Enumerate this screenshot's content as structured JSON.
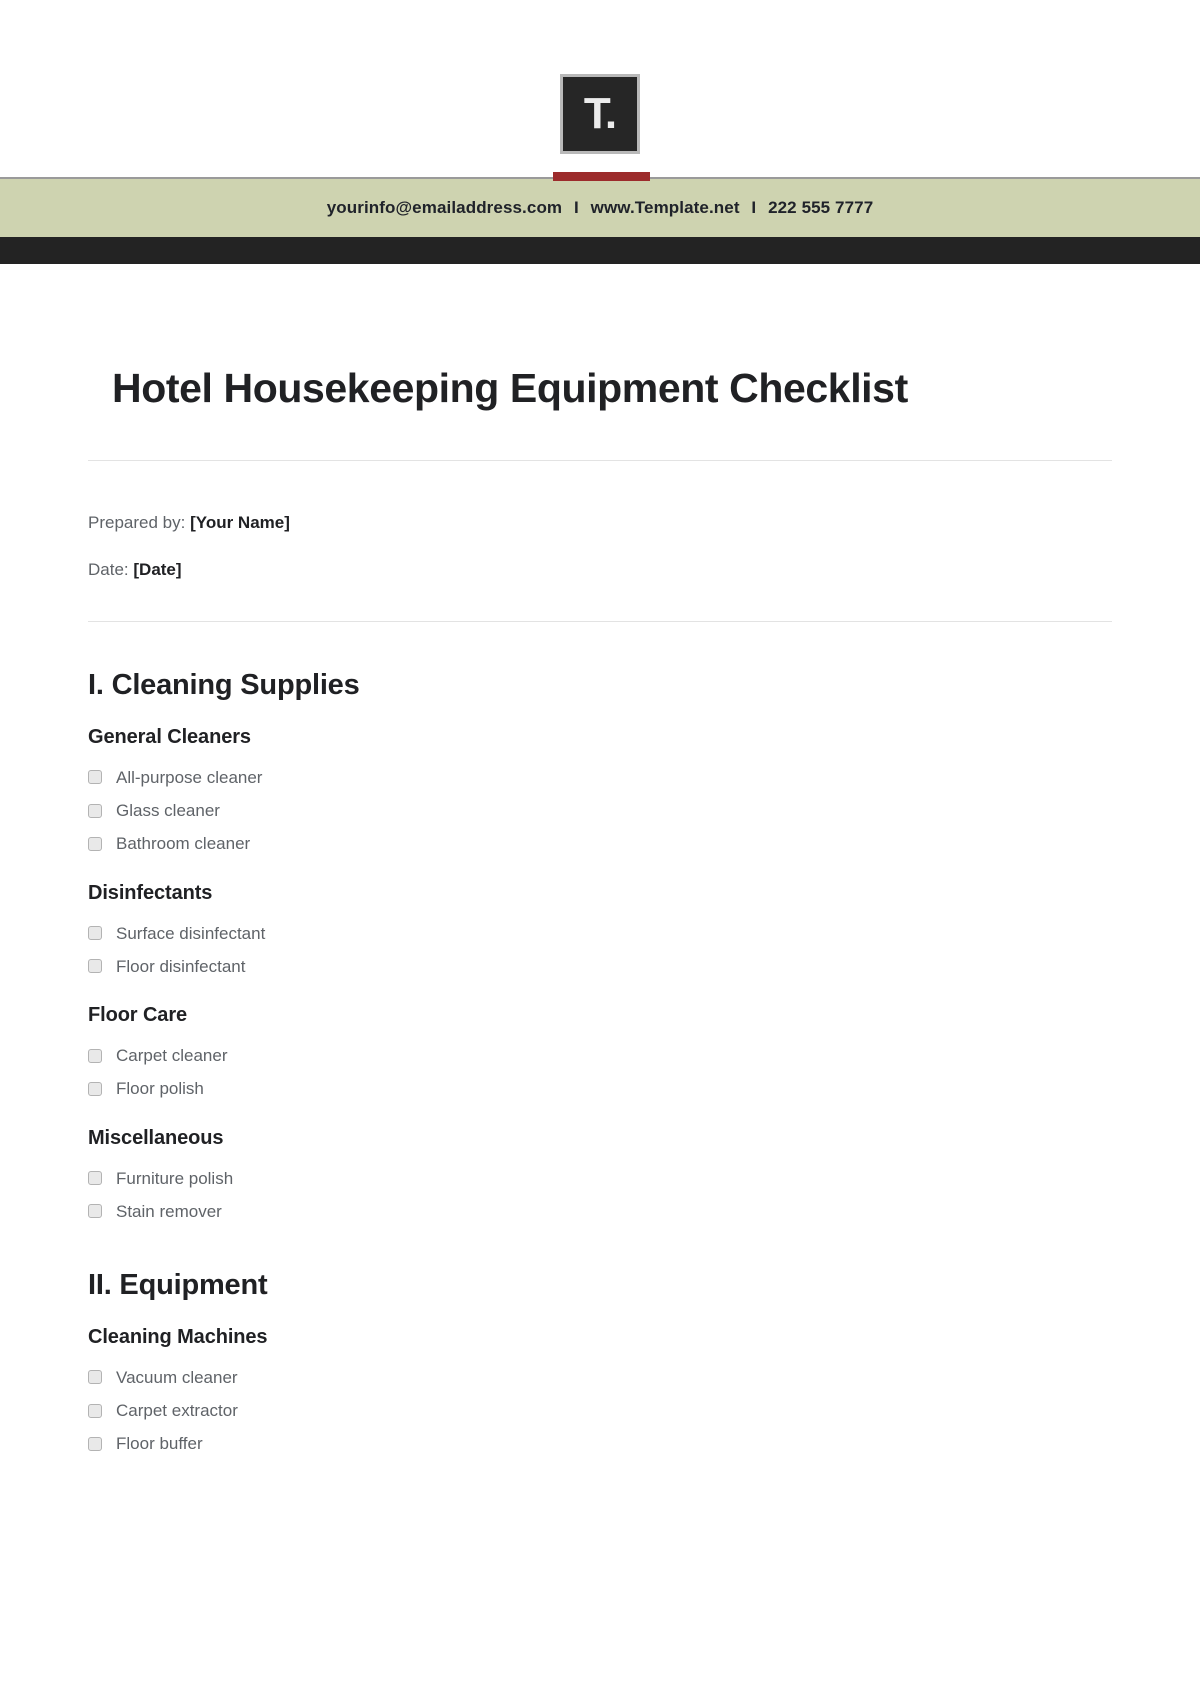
{
  "brand": {
    "logo_mark": "T.",
    "logo_icon": "template-net-logo-icon",
    "accent_red": "#9C2B2B",
    "band_green": "#CED3B0",
    "band_dark": "#232323"
  },
  "contact": {
    "email": "yourinfo@emailaddress.com",
    "separator": "I",
    "website": "www.Template.net",
    "phone": "222 555 7777"
  },
  "document": {
    "title": "Hotel Housekeeping Equipment Checklist",
    "prepared_by_label": "Prepared by:",
    "prepared_by_value": "[Your Name]",
    "date_label": "Date:",
    "date_value": "[Date]"
  },
  "sections": [
    {
      "title": "I. Cleaning Supplies",
      "groups": [
        {
          "title": "General Cleaners",
          "items": [
            {
              "label": "All-purpose cleaner",
              "checked": false
            },
            {
              "label": "Glass cleaner",
              "checked": false
            },
            {
              "label": "Bathroom cleaner",
              "checked": false
            }
          ]
        },
        {
          "title": "Disinfectants",
          "items": [
            {
              "label": "Surface disinfectant",
              "checked": false
            },
            {
              "label": "Floor disinfectant",
              "checked": false
            }
          ]
        },
        {
          "title": "Floor Care",
          "items": [
            {
              "label": "Carpet cleaner",
              "checked": false
            },
            {
              "label": "Floor polish",
              "checked": false
            }
          ]
        },
        {
          "title": "Miscellaneous",
          "items": [
            {
              "label": "Furniture polish",
              "checked": false
            },
            {
              "label": "Stain remover",
              "checked": false
            }
          ]
        }
      ]
    },
    {
      "title": "II. Equipment",
      "groups": [
        {
          "title": "Cleaning Machines",
          "items": [
            {
              "label": "Vacuum cleaner",
              "checked": false
            },
            {
              "label": "Carpet extractor",
              "checked": false
            },
            {
              "label": "Floor buffer",
              "checked": false
            }
          ]
        }
      ]
    }
  ]
}
